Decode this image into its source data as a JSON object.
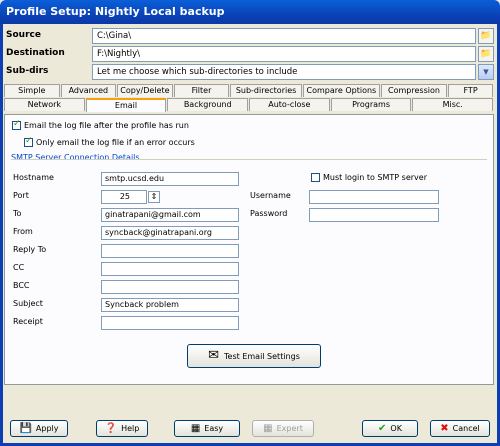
{
  "window": {
    "title": "Profile Setup: Nightly Local backup"
  },
  "paths": {
    "source_label": "Source",
    "source_value": "C:\\Gina\\",
    "destination_label": "Destination",
    "destination_value": "F:\\Nightly\\",
    "subdirs_label": "Sub-dirs",
    "subdirs_value": "Let me choose which sub-directories to include"
  },
  "tabs_row1": [
    "Simple",
    "Advanced",
    "Copy/Delete",
    "Filter",
    "Sub-directories",
    "Compare Options",
    "Compression",
    "FTP"
  ],
  "tabs_row2": [
    "Network",
    "Email",
    "Background",
    "Auto-close",
    "Programs",
    "Misc."
  ],
  "email": {
    "email_log_label": "Email the log file after the profile has run",
    "only_error_label": "Only email the log file if an error occurs",
    "smtp_group": "SMTP Server Connection Details",
    "hostname_label": "Hostname",
    "hostname_value": "smtp.ucsd.edu",
    "port_label": "Port",
    "port_value": "25",
    "to_label": "To",
    "to_value": "ginatrapani@gmail.com",
    "from_label": "From",
    "from_value": "syncback@ginatrapani.org",
    "replyto_label": "Reply To",
    "cc_label": "CC",
    "bcc_label": "BCC",
    "subject_label": "Subject",
    "subject_value": "Syncback problem",
    "receipt_label": "Receipt",
    "must_login_label": "Must login to SMTP server",
    "username_label": "Username",
    "password_label": "Password",
    "test_button": "Test Email Settings"
  },
  "buttons": {
    "apply": "Apply",
    "help": "Help",
    "easy": "Easy",
    "expert": "Expert",
    "ok": "OK",
    "cancel": "Cancel"
  },
  "colors": {
    "accent": "#0b3fb3",
    "tab_highlight": "#f1a20f"
  }
}
